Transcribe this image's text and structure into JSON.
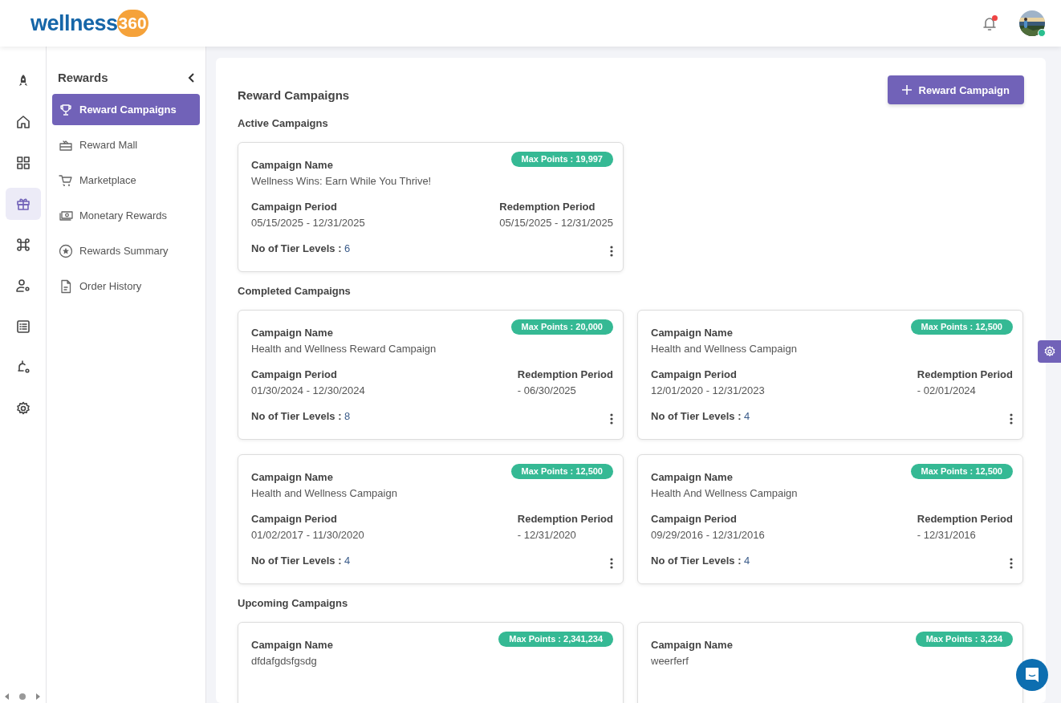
{
  "header": {
    "logo": {
      "word": "wellness",
      "number": "360"
    },
    "notifications": {
      "unread": true
    },
    "user": {
      "online": true
    }
  },
  "rail": {
    "items": [
      {
        "selected": false
      },
      {
        "selected": false
      },
      {
        "selected": false
      },
      {
        "selected": true
      },
      {
        "selected": false
      },
      {
        "selected": false
      },
      {
        "selected": false
      },
      {
        "selected": false
      },
      {
        "selected": false
      }
    ]
  },
  "sidebar": {
    "title": "Rewards",
    "items": [
      {
        "label": "Reward Campaigns",
        "selected": true
      },
      {
        "label": "Reward Mall",
        "selected": false
      },
      {
        "label": "Marketplace",
        "selected": false
      },
      {
        "label": "Monetary Rewards",
        "selected": false
      },
      {
        "label": "Rewards Summary",
        "selected": false
      },
      {
        "label": "Order History",
        "selected": false
      }
    ]
  },
  "page": {
    "title": "Reward Campaigns",
    "add_button": "Reward Campaign",
    "sections": [
      {
        "title": "Active Campaigns",
        "campaigns": [
          {
            "max_points": "Max Points : 19,997",
            "name_label": "Campaign Name",
            "name": "Wellness Wins: Earn While You Thrive!",
            "period_label": "Campaign Period",
            "period": "05/15/2025 - 12/31/2025",
            "redemption_label": "Redemption Period",
            "redemption": "05/15/2025 - 12/31/2025",
            "tiers": "**No of Tier Levels :** 6"
          }
        ]
      },
      {
        "title": "Completed Campaigns",
        "campaigns": [
          {
            "max_points": "Max Points : 20,000",
            "name_label": "Campaign Name",
            "name": "Health and Wellness Reward Campaign",
            "period_label": "Campaign Period",
            "period": "01/30/2024 - 12/30/2024",
            "redemption_label": "Redemption Period",
            "redemption": "- 06/30/2025",
            "tiers": "**No of Tier Levels :** 8"
          },
          {
            "max_points": "Max Points : 12,500",
            "name_label": "Campaign Name",
            "name": "Health and Wellness Campaign",
            "period_label": "Campaign Period",
            "period": "12/01/2020 - 12/31/2023",
            "redemption_label": "Redemption Period",
            "redemption": "- 02/01/2024",
            "tiers": "**No of Tier Levels :** 4"
          },
          {
            "max_points": "Max Points : 12,500",
            "name_label": "Campaign Name",
            "name": "Health and Wellness Campaign",
            "period_label": "Campaign Period",
            "period": "01/02/2017 - 11/30/2020",
            "redemption_label": "Redemption Period",
            "redemption": "- 12/31/2020",
            "tiers": "**No of Tier Levels :** 4"
          },
          {
            "max_points": "Max Points : 12,500",
            "name_label": "Campaign Name",
            "name": "Health And Wellness Campaign",
            "period_label": "Campaign Period",
            "period": "09/29/2016 - 12/31/2016",
            "redemption_label": "Redemption Period",
            "redemption": "- 12/31/2016",
            "tiers": "**No of Tier Levels :** 4"
          }
        ]
      },
      {
        "title": "Upcoming Campaigns",
        "campaigns": [
          {
            "max_points": "Max Points : 2,341,234",
            "name_label": "Campaign Name",
            "name": "dfdafgdsfgsdg"
          },
          {
            "max_points": "Max Points : 3,234",
            "name_label": "Campaign Name",
            "name": "weerferf"
          }
        ]
      }
    ]
  }
}
